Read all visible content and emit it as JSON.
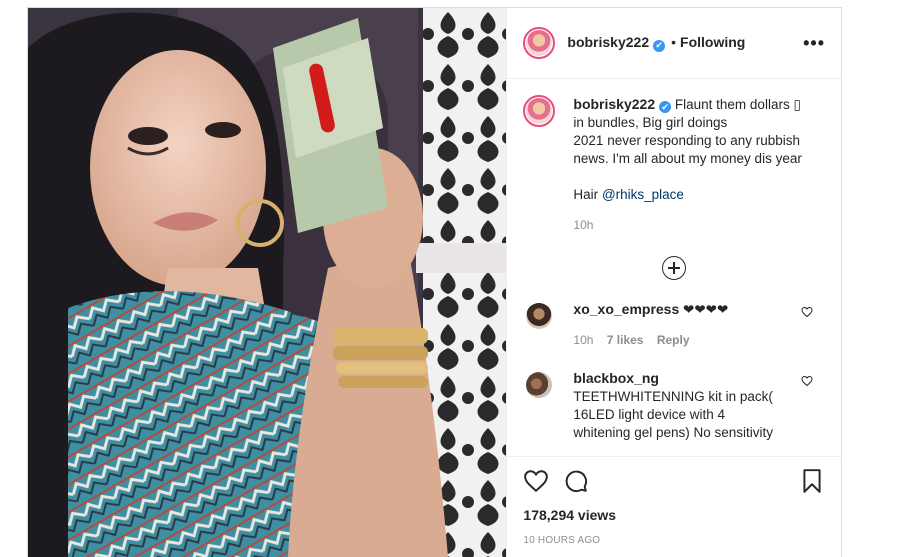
{
  "header": {
    "username": "bobrisky222",
    "verified_glyph": "✔",
    "dot": "•",
    "following": "Following",
    "more": "•••"
  },
  "caption": {
    "username": "bobrisky222",
    "verified_glyph": "✔",
    "text": "Flaunt them dollars ▯ in bundles, Big girl doings\n2021 never responding to any rubbish news. I'm all about my money dis year",
    "hair_label": "Hair",
    "mention": "@rhiks_place",
    "time": "10h"
  },
  "comments": [
    {
      "username": "xo_xo_empress",
      "text": "❤❤❤❤",
      "time": "10h",
      "likes": "7 likes",
      "reply": "Reply"
    },
    {
      "username": "blackbox_ng",
      "text": "TEETHWHITENNING kit in pack( 16LED light device with 4 whitening gel pens) No sensitivity"
    }
  ],
  "footer": {
    "views": "178,294 views",
    "posted": "10 HOURS AGO"
  },
  "icons": [
    "heart-icon",
    "comment-icon",
    "bookmark-icon",
    "plus-circle-icon",
    "more-icon",
    "verified-icon"
  ]
}
